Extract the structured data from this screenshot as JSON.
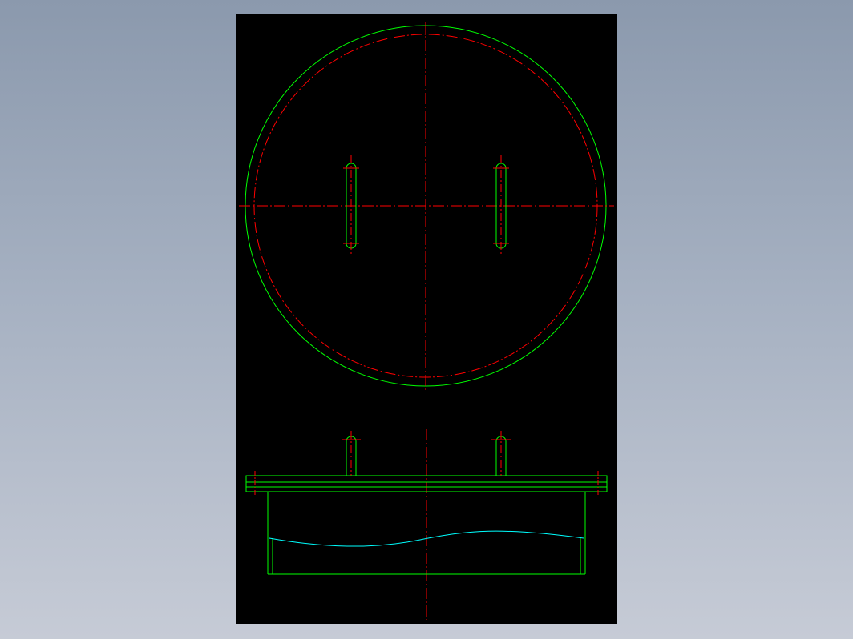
{
  "colors": {
    "background_gradient_top": "#8b99ad",
    "background_gradient_bottom": "#c6cbd6",
    "sheet": "#000000",
    "outline": "#00ff00",
    "centerline": "#ff0000",
    "break_line": "#00ffff"
  },
  "drawing": {
    "views": [
      "plan-view",
      "elevation-view"
    ],
    "plan_view": {
      "slot_holes": 2
    },
    "elevation_view": {
      "handles": 2
    }
  }
}
